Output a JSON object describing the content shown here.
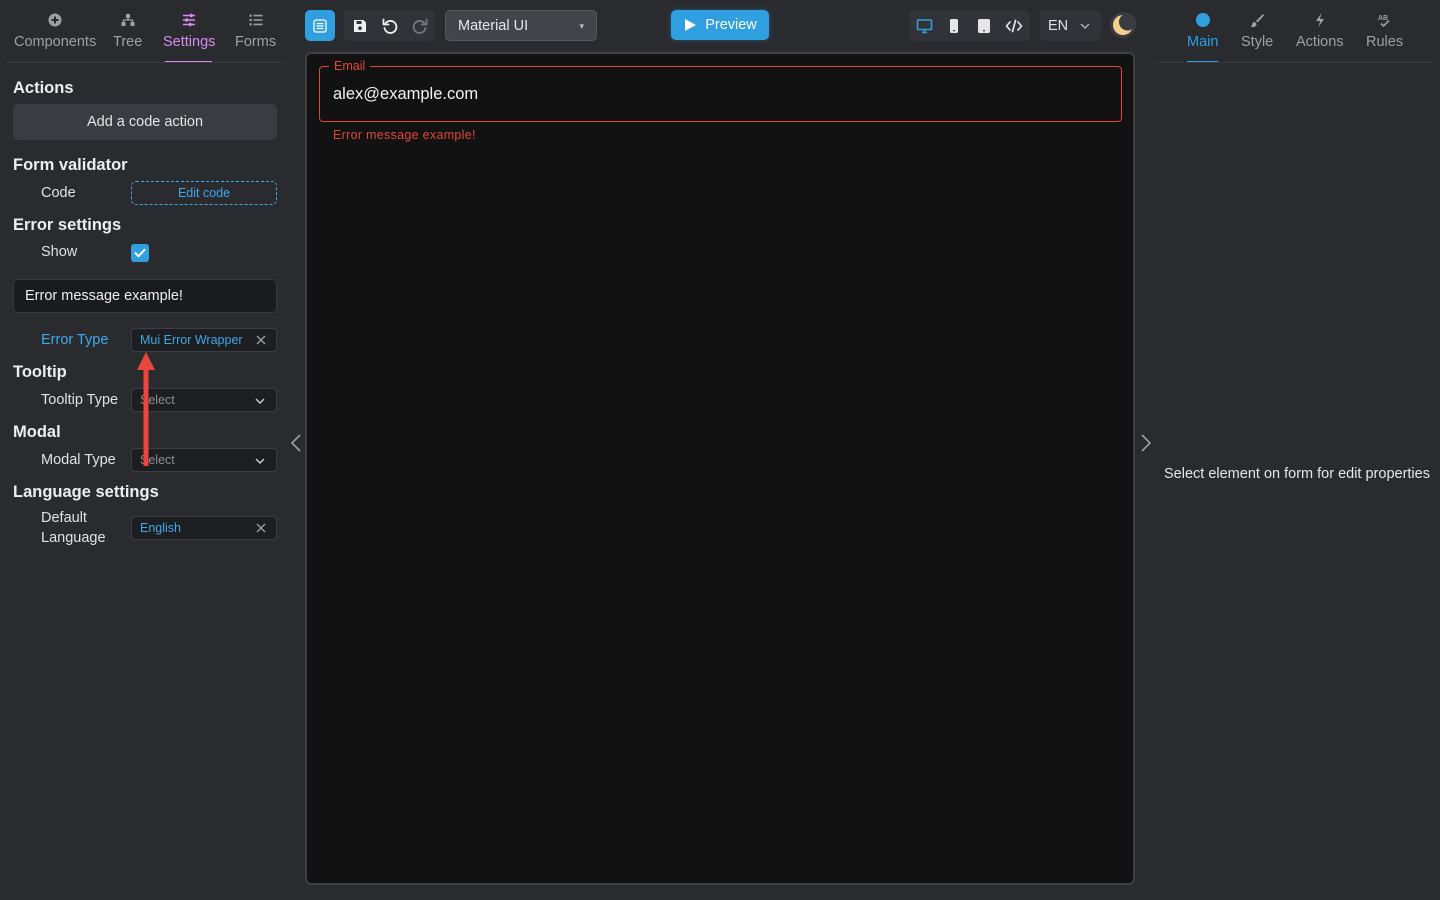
{
  "left_tabs": [
    {
      "label": "Components",
      "icon": "plus-circle-icon"
    },
    {
      "label": "Tree",
      "icon": "tree-icon"
    },
    {
      "label": "Settings",
      "icon": "sliders-icon",
      "active": true
    },
    {
      "label": "Forms",
      "icon": "list-icon"
    }
  ],
  "actions": {
    "title": "Actions",
    "add_button": "Add a code action"
  },
  "form_validator": {
    "title": "Form validator",
    "code_label": "Code",
    "edit_button": "Edit code"
  },
  "error_settings": {
    "title": "Error settings",
    "show_label": "Show",
    "show_checked": true,
    "message_value": "Error message example!",
    "error_type_label": "Error Type",
    "error_type_value": "Mui Error Wrapper"
  },
  "tooltip": {
    "title": "Tooltip",
    "type_label": "Tooltip Type",
    "type_placeholder": "Select"
  },
  "modal": {
    "title": "Modal",
    "type_label": "Modal Type",
    "type_placeholder": "Select"
  },
  "language_settings": {
    "title": "Language settings",
    "default_label_line1": "Default",
    "default_label_line2": "Language",
    "default_value": "English"
  },
  "toolbar": {
    "theme_value": "Material UI",
    "preview_label": "Preview",
    "language": "EN",
    "accent_color": "#2f9fe0"
  },
  "canvas": {
    "field_label": "Email",
    "field_value": "alex@example.com",
    "error_text": "Error message example!",
    "error_color": "#e0473a"
  },
  "right_tabs": [
    {
      "label": "Main",
      "icon": "dot-icon",
      "active": true
    },
    {
      "label": "Style",
      "icon": "brush-icon"
    },
    {
      "label": "Actions",
      "icon": "lightning-icon"
    },
    {
      "label": "Rules",
      "icon": "rules-icon"
    }
  ],
  "right_panel": {
    "hint": "Select element on form for edit properties"
  }
}
